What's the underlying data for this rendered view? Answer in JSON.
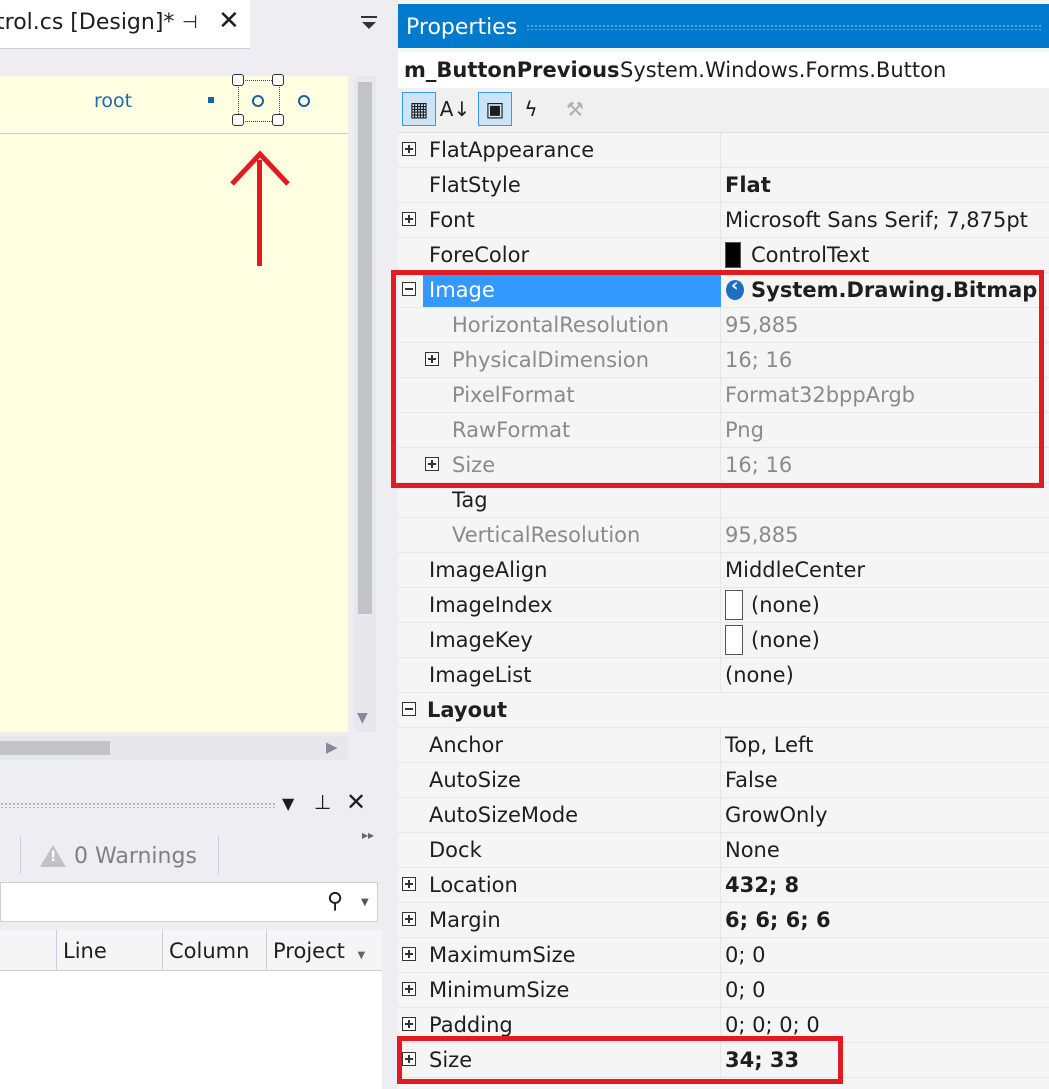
{
  "designer": {
    "tab_title": "trol.cs [Design]*",
    "root_label": "root"
  },
  "error_list": {
    "warnings": "0 Warnings",
    "columns": [
      "Line",
      "Column",
      "Project"
    ]
  },
  "properties": {
    "title": "Properties",
    "object_name": "m_ButtonPrevious",
    "object_type": "System.Windows.Forms.Button",
    "rows": [
      {
        "name": "FlatAppearance",
        "value": ""
      },
      {
        "name": "FlatStyle",
        "value": "Flat"
      },
      {
        "name": "Font",
        "value": "Microsoft Sans Serif; 7,875pt"
      },
      {
        "name": "ForeColor",
        "value": "ControlText"
      },
      {
        "name": "Image",
        "value": "System.Drawing.Bitmap"
      },
      {
        "name": "HorizontalResolution",
        "value": "95,885"
      },
      {
        "name": "PhysicalDimension",
        "value": "16; 16"
      },
      {
        "name": "PixelFormat",
        "value": "Format32bppArgb"
      },
      {
        "name": "RawFormat",
        "value": "Png"
      },
      {
        "name": "Size",
        "value": "16; 16"
      },
      {
        "name": "Tag",
        "value": ""
      },
      {
        "name": "VerticalResolution",
        "value": "95,885"
      },
      {
        "name": "ImageAlign",
        "value": "MiddleCenter"
      },
      {
        "name": "ImageIndex",
        "value": "(none)"
      },
      {
        "name": "ImageKey",
        "value": "(none)"
      },
      {
        "name": "ImageList",
        "value": "(none)"
      },
      {
        "name": "Layout",
        "value": ""
      },
      {
        "name": "Anchor",
        "value": "Top, Left"
      },
      {
        "name": "AutoSize",
        "value": "False"
      },
      {
        "name": "AutoSizeMode",
        "value": "GrowOnly"
      },
      {
        "name": "Dock",
        "value": "None"
      },
      {
        "name": "Location",
        "value": "432; 8"
      },
      {
        "name": "Margin",
        "value": "6; 6; 6; 6"
      },
      {
        "name": "MaximumSize",
        "value": "0; 0"
      },
      {
        "name": "MinimumSize",
        "value": "0; 0"
      },
      {
        "name": "Padding",
        "value": "0; 0; 0; 0"
      },
      {
        "name": "Size",
        "value": "34; 33"
      }
    ]
  },
  "colors": {
    "accent": "#007acc",
    "selection": "#3399ff",
    "annotation": "#e21b23",
    "designer_bg": "#ffffe1"
  }
}
